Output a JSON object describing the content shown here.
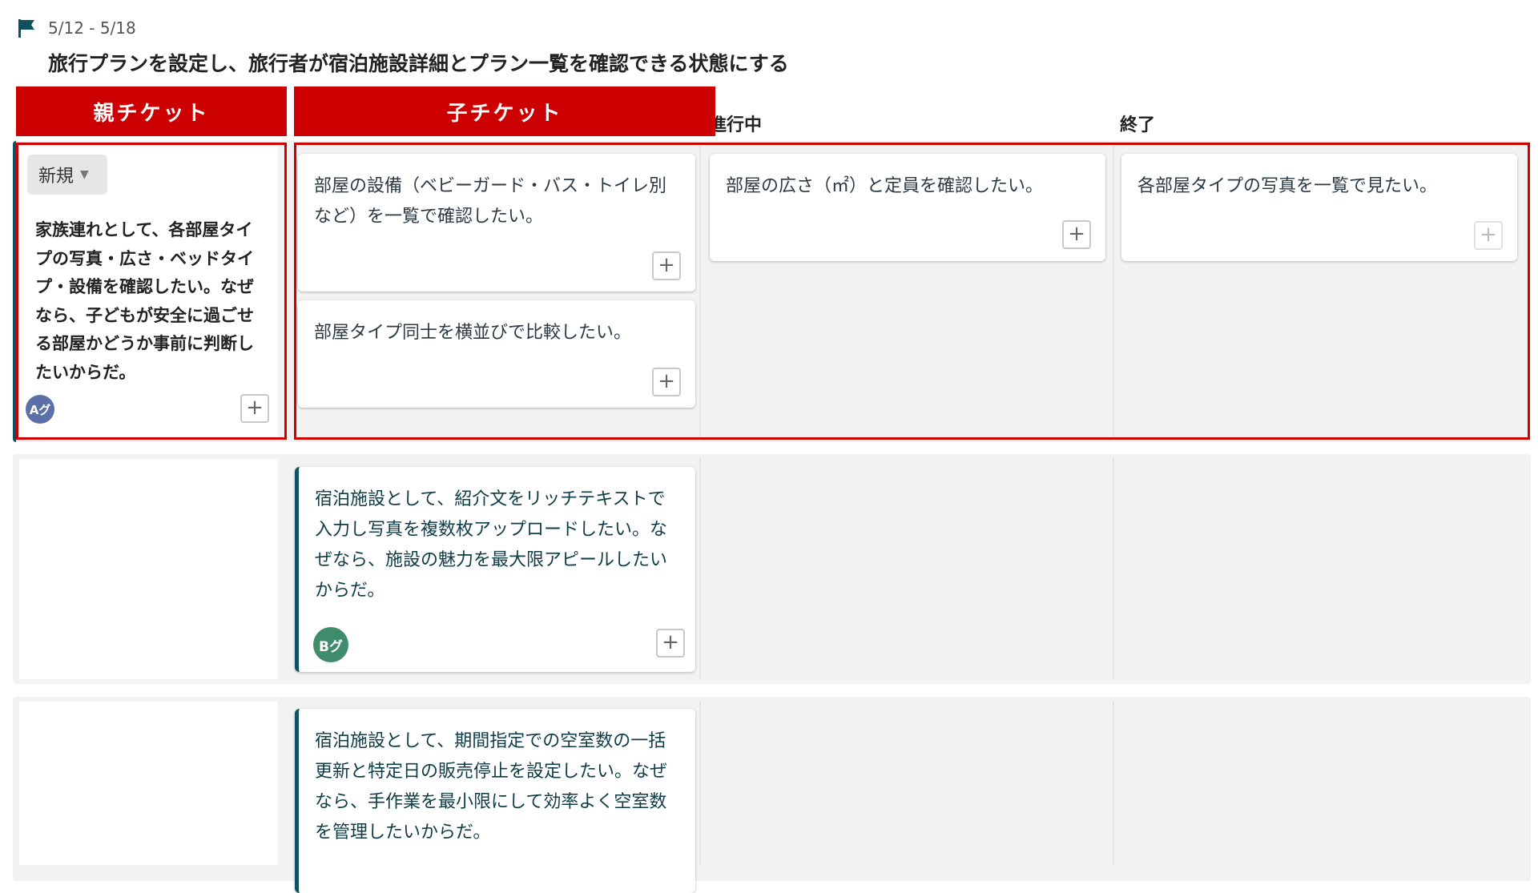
{
  "sprint": {
    "dates": "5/12 - 5/18",
    "goal": "旅行プランを設定し、旅行者が宿泊施設詳細とプラン一覧を確認できる状態にする"
  },
  "banners": {
    "parent": "親チケット",
    "child": "子チケット"
  },
  "columns": {
    "in_progress": "進行中",
    "done": "終了"
  },
  "parent_card": {
    "status": "新規",
    "description": "家族連れとして、各部屋タイプの写真・広さ・ベッドタイプ・設備を確認したい。なぜなら、子どもが安全に過ごせる部屋かどうか事前に判断したいからだ。",
    "assignee_initials": "Aグ"
  },
  "cards": {
    "todo_1": "部屋の設備（ベビーガード・バス・トイレ別など）を一覧で確認したい。",
    "todo_2": "部屋タイプ同士を横並びで比較したい。",
    "inprogress_1": "部屋の広さ（㎡）と定員を確認したい。",
    "done_1": "各部屋タイプの写真を一覧で見たい。",
    "lane2_card": "宿泊施設として、紹介文をリッチテキストで入力し写真を複数枚アップロードしたい。なぜなら、施設の魅力を最大限アピールしたいからだ。",
    "lane2_assignee": "Bグ",
    "lane3_card": "宿泊施設として、期間指定での空室数の一括更新と特定日の販売停止を設定したい。なぜなら、手作業を最小限にして効率よく空室数を管理したいからだ。"
  },
  "plus_label": "+",
  "colors": {
    "banner_red": "#cc0000",
    "accent_teal": "#0e5160",
    "lane_bg": "#f2f2f2"
  },
  "icons": {
    "flag": "flag-icon"
  }
}
